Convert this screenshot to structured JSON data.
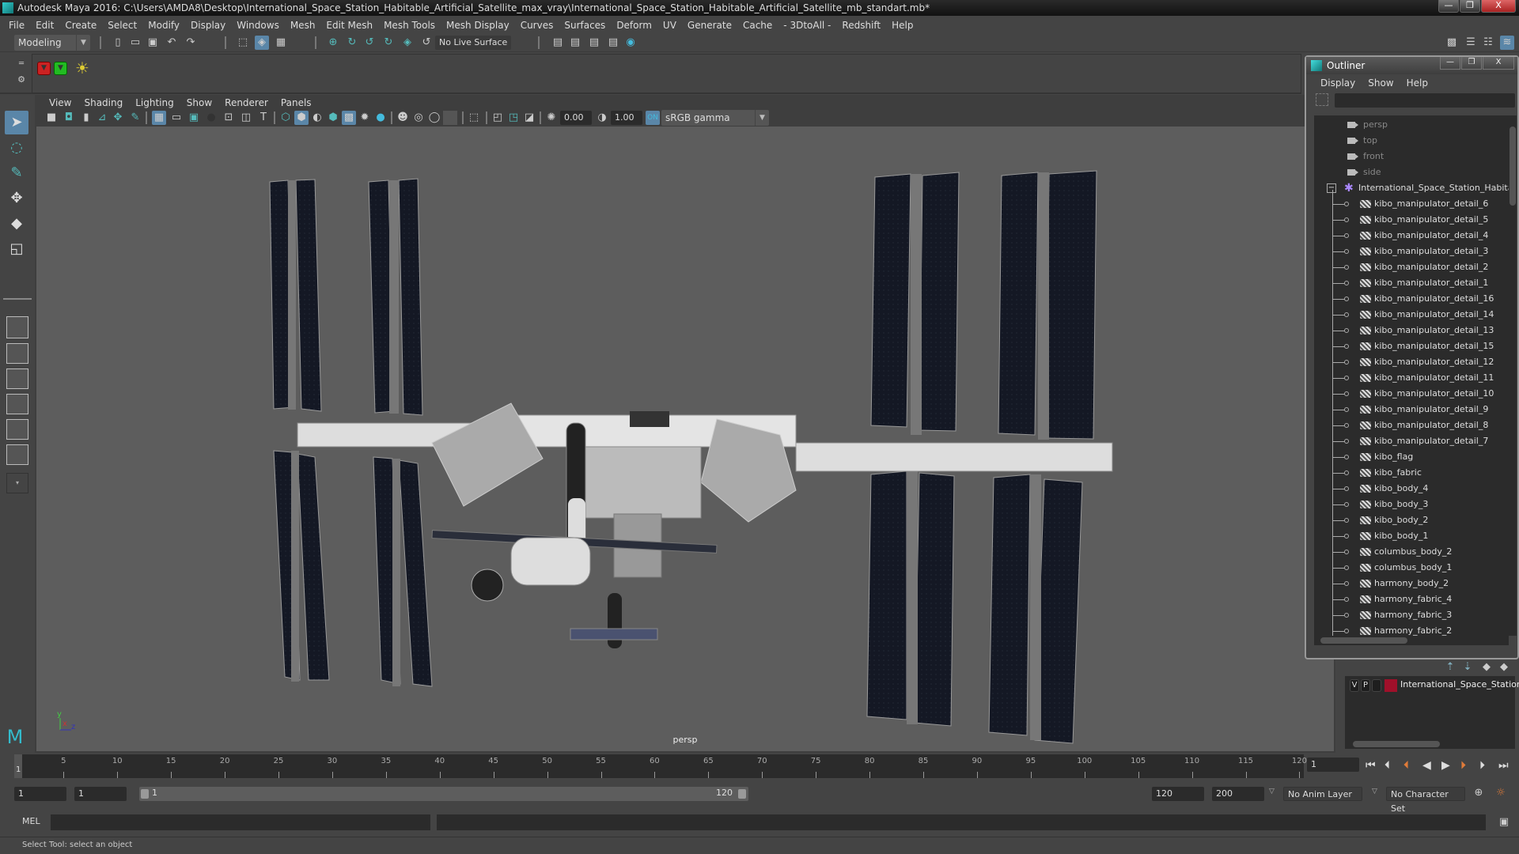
{
  "window": {
    "title": "Autodesk Maya 2016: C:\\Users\\AMDA8\\Desktop\\International_Space_Station_Habitable_Artificial_Satellite_max_vray\\International_Space_Station_Habitable_Artificial_Satellite_mb_standart.mb*",
    "minimize": "—",
    "maximize": "❐",
    "close": "X"
  },
  "menubar": [
    "File",
    "Edit",
    "Create",
    "Select",
    "Modify",
    "Display",
    "Windows",
    "Mesh",
    "Edit Mesh",
    "Mesh Tools",
    "Mesh Display",
    "Curves",
    "Surfaces",
    "Deform",
    "UV",
    "Generate",
    "Cache",
    "- 3DtoAll -",
    "Redshift",
    "Help"
  ],
  "statusline": {
    "mode": "Modeling",
    "live_surface": "No Live Surface"
  },
  "panel": {
    "menu": [
      "View",
      "Shading",
      "Lighting",
      "Show",
      "Renderer",
      "Panels"
    ],
    "exposure": "0.00",
    "gamma": "1.00",
    "color_space": "sRGB gamma",
    "camera_label": "persp",
    "axis": {
      "y": "y",
      "x": "x",
      "z": "z"
    }
  },
  "outliner": {
    "title": "Outliner",
    "menu": [
      "Display",
      "Show",
      "Help"
    ],
    "cameras": [
      "persp",
      "top",
      "front",
      "side"
    ],
    "root": "International_Space_Station_Habita",
    "items": [
      "kibo_manipulator_detail_6",
      "kibo_manipulator_detail_5",
      "kibo_manipulator_detail_4",
      "kibo_manipulator_detail_3",
      "kibo_manipulator_detail_2",
      "kibo_manipulator_detail_1",
      "kibo_manipulator_detail_16",
      "kibo_manipulator_detail_14",
      "kibo_manipulator_detail_13",
      "kibo_manipulator_detail_15",
      "kibo_manipulator_detail_12",
      "kibo_manipulator_detail_11",
      "kibo_manipulator_detail_10",
      "kibo_manipulator_detail_9",
      "kibo_manipulator_detail_8",
      "kibo_manipulator_detail_7",
      "kibo_flag",
      "kibo_fabric",
      "kibo_body_4",
      "kibo_body_3",
      "kibo_body_2",
      "kibo_body_1",
      "columbus_body_2",
      "columbus_body_1",
      "harmony_body_2",
      "harmony_fabric_4",
      "harmony_fabric_3",
      "harmony_fabric_2"
    ]
  },
  "layers": {
    "row": {
      "v": "V",
      "p": "P",
      "name": "International_Space_Station_H",
      "color": "#a0102a"
    }
  },
  "timeline": {
    "ticks": [
      5,
      10,
      15,
      20,
      25,
      30,
      35,
      40,
      45,
      50,
      55,
      60,
      65,
      70,
      75,
      80,
      85,
      90,
      95,
      100,
      105,
      110,
      115,
      120
    ],
    "current_frame": "1",
    "current_field": "1"
  },
  "range": {
    "start": "1",
    "playback_start": "1",
    "slider_start": "1",
    "slider_end": "120",
    "playback_end": "120",
    "end": "200",
    "anim_layer": "No Anim Layer",
    "character_set": "No Character Set"
  },
  "cmdline": {
    "label": "MEL"
  },
  "helpline": {
    "text": "Select Tool: select an object"
  },
  "colors": {
    "accent": "#5a86a8",
    "keyframe": "#e07b39",
    "layer": "#a0102a"
  }
}
